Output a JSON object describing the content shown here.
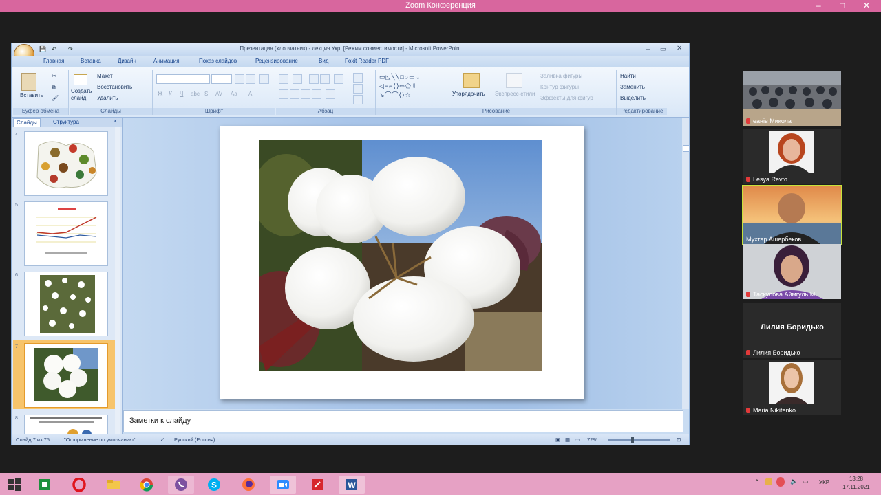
{
  "zoom": {
    "title": "Zoom Конференция",
    "minimize": "–",
    "maximize": "□",
    "close": "✕"
  },
  "ppt": {
    "window_title": "Презентация (хлопчатник) - лекция Укр. [Режим совместимости] - Microsoft PowerPoint",
    "tabs": [
      "Главная",
      "Вставка",
      "Дизайн",
      "Анимация",
      "Показ слайдов",
      "Рецензирование",
      "Вид",
      "Foxit Reader PDF"
    ],
    "groups": {
      "clipboard": {
        "label": "Буфер обмена",
        "paste": "Вставить"
      },
      "slides": {
        "label": "Слайды",
        "new_slide": "Создать слайд",
        "layout": "Макет",
        "reset": "Восстановить",
        "delete": "Удалить"
      },
      "font": {
        "label": "Шрифт"
      },
      "paragraph": {
        "label": "Абзац"
      },
      "drawing": {
        "label": "Рисование",
        "arrange": "Упорядочить",
        "quick_styles": "Экспресс-стили",
        "fill": "Заливка фигуры",
        "outline": "Контур фигуры",
        "effects": "Эффекты для фигур"
      },
      "editing": {
        "label": "Редактирование",
        "find": "Найти",
        "replace": "Заменить",
        "select": "Выделить"
      }
    },
    "panel_tabs": [
      "Слайды",
      "Структура"
    ],
    "thumbnails": [
      {
        "num": "4"
      },
      {
        "num": "5"
      },
      {
        "num": "6"
      },
      {
        "num": "7"
      },
      {
        "num": "8"
      }
    ],
    "notes_placeholder": "Заметки к слайду",
    "status": {
      "slide": "Слайд 7 из 75",
      "theme": "\"Оформление по умолчанию\"",
      "language": "Русский (Россия)",
      "zoom": "72%"
    }
  },
  "participants": [
    {
      "name": "еанів Микола"
    },
    {
      "name": "Lesya Revto"
    },
    {
      "name": "Мухтар Ашербеков"
    },
    {
      "name": "Таскулова Аймгуль М..."
    },
    {
      "name": "Лилия Боридько",
      "display": "Лилия Боридько"
    },
    {
      "name": "Maria Nikitenko"
    }
  ],
  "taskbar": {
    "lang": "УКР",
    "time": "13:28",
    "date": "17.11.2021"
  },
  "colors": {
    "zoom_title": "#d8669e",
    "taskbar": "#e6a1c4",
    "active_speaker": "#c7e23a"
  }
}
